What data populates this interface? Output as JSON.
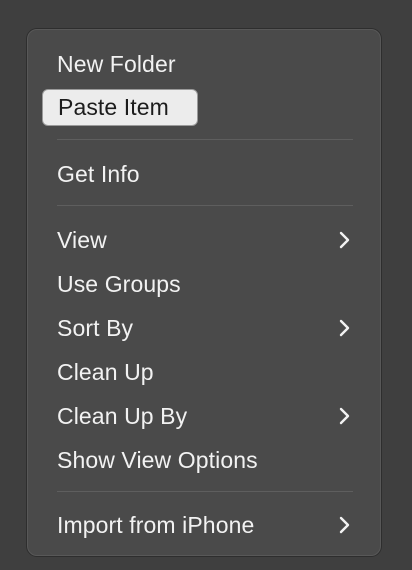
{
  "context_menu": {
    "items": [
      {
        "label": "New Folder",
        "has_submenu": false
      },
      {
        "label": "Paste Item",
        "has_submenu": false,
        "highlighted": true
      },
      {
        "label": "Get Info",
        "has_submenu": false
      },
      {
        "label": "View",
        "has_submenu": true
      },
      {
        "label": "Use Groups",
        "has_submenu": false
      },
      {
        "label": "Sort By",
        "has_submenu": true
      },
      {
        "label": "Clean Up",
        "has_submenu": false
      },
      {
        "label": "Clean Up By",
        "has_submenu": true
      },
      {
        "label": "Show View Options",
        "has_submenu": false
      },
      {
        "label": "Import from iPhone",
        "has_submenu": true
      }
    ],
    "submenu_icon": "chevron-right-icon",
    "colors": {
      "menu_background": "#4a4a4a",
      "highlight_background": "#ececec",
      "text": "#f2f2f2",
      "highlight_text": "#1c1c1c"
    }
  }
}
